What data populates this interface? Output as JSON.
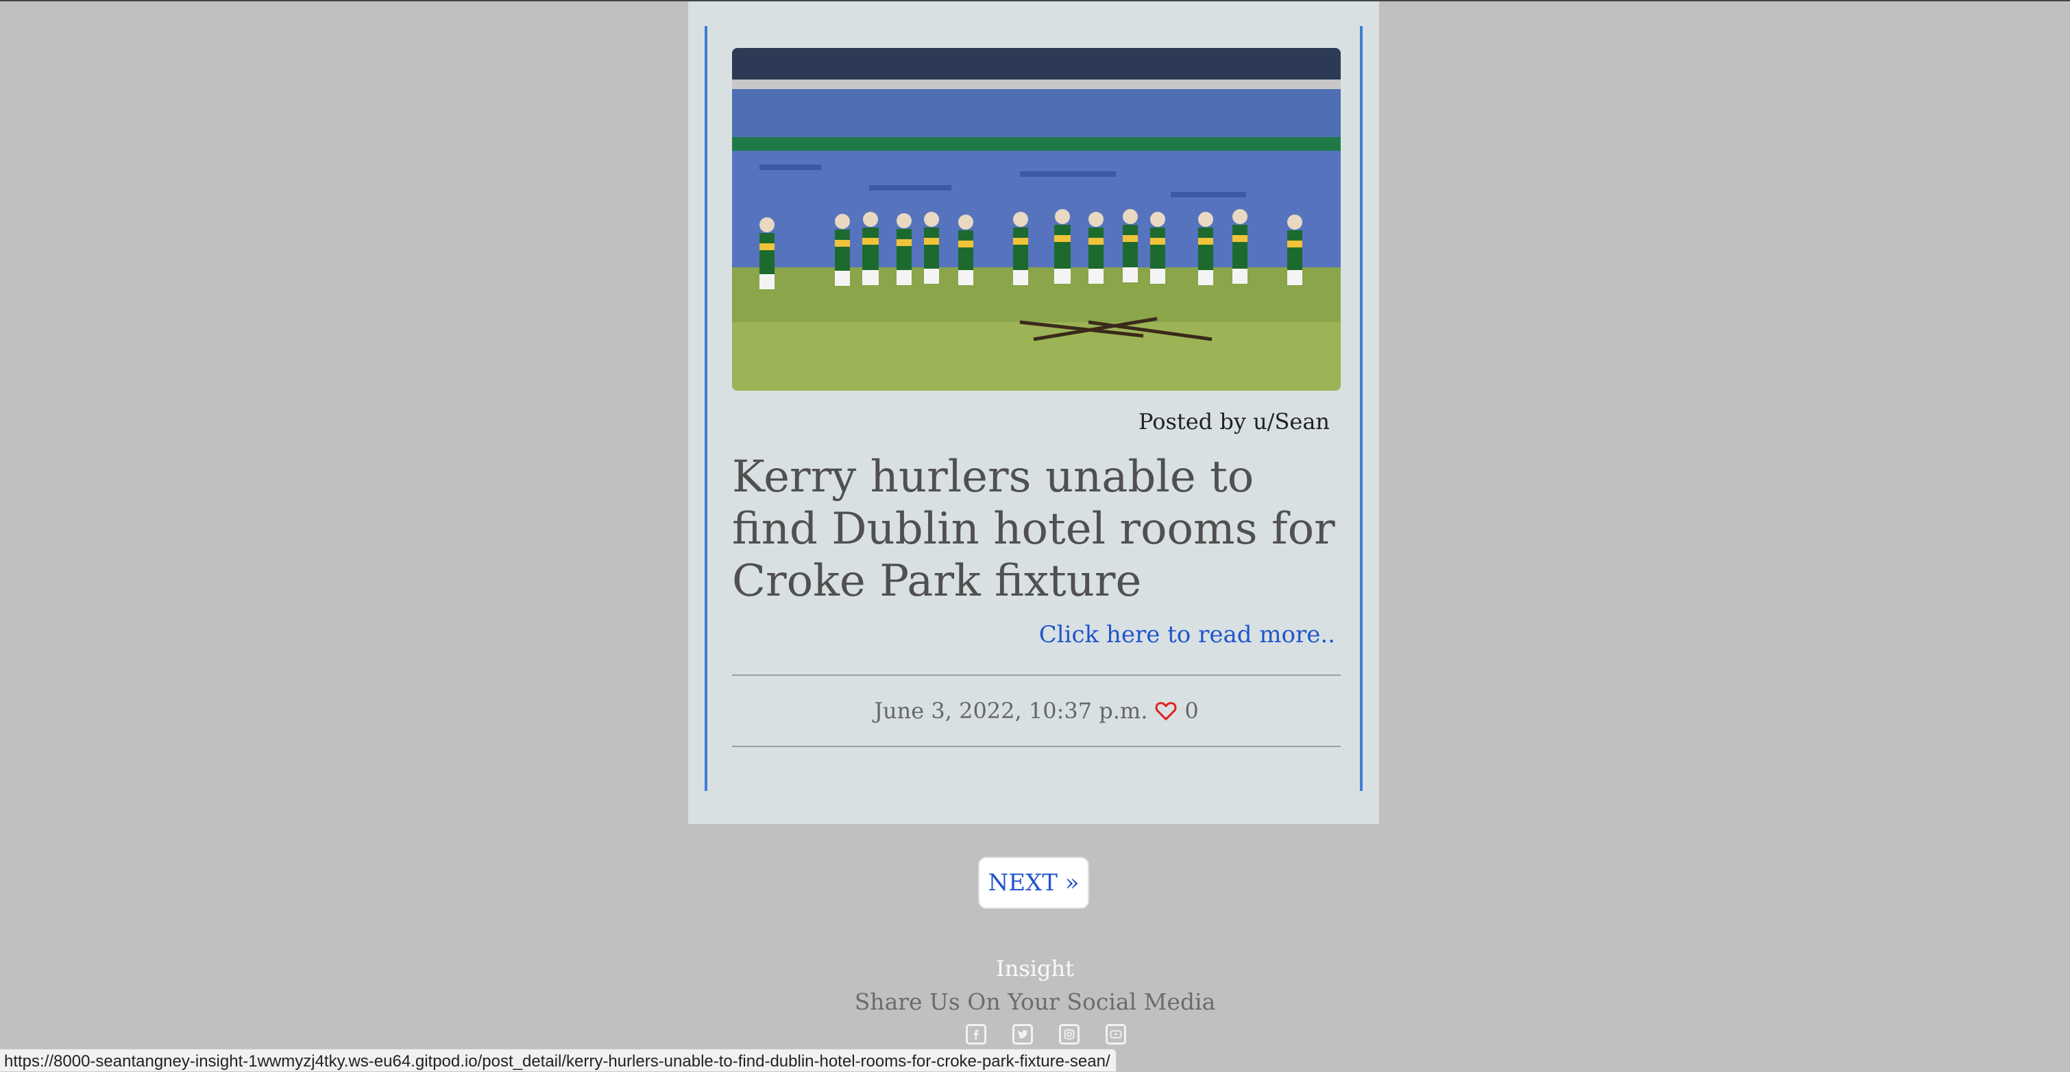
{
  "post": {
    "author": "Posted by u/Sean",
    "title": "Kerry hurlers unable to find Dublin hotel rooms for Croke Park fixture",
    "read_more": "Click here to read more..",
    "date": "June 3, 2022, 10:37 p.m.",
    "likes": "0",
    "image_icon": "stadium-photo"
  },
  "pagination": {
    "next_label": "NEXT »"
  },
  "footer": {
    "brand": "Insight",
    "share_text": "Share Us On Your Social Media",
    "socials": [
      "facebook-icon",
      "twitter-icon",
      "instagram-icon",
      "youtube-icon"
    ]
  },
  "status_bar": {
    "url": "https://8000-seantangney-insight-1wwmyzj4tky.ws-eu64.gitpod.io/post_detail/kerry-hurlers-unable-to-find-dublin-hotel-rooms-for-croke-park-fixture-sean/"
  },
  "colors": {
    "accent": "#3f7dd6",
    "link": "#2255cc",
    "heart": "#e02020",
    "page_bg": "#c0c0c0",
    "card_bg": "#d8e0e2"
  }
}
